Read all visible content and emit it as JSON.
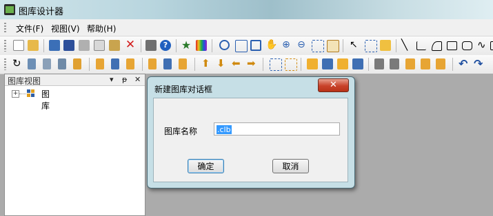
{
  "window": {
    "title": "图库设计器"
  },
  "menu": [
    "文件(F)",
    "视图(V)",
    "帮助(H)"
  ],
  "panel": {
    "title": "图库视图",
    "pin": "▾",
    "pin2": "ᵽ",
    "close": "✕",
    "tree_root": "图库"
  },
  "dialog": {
    "title": "新建图库对话框",
    "close": "✕",
    "name_label": "图库名称",
    "name_value": ".clb",
    "ok": "确定",
    "cancel": "取消"
  }
}
